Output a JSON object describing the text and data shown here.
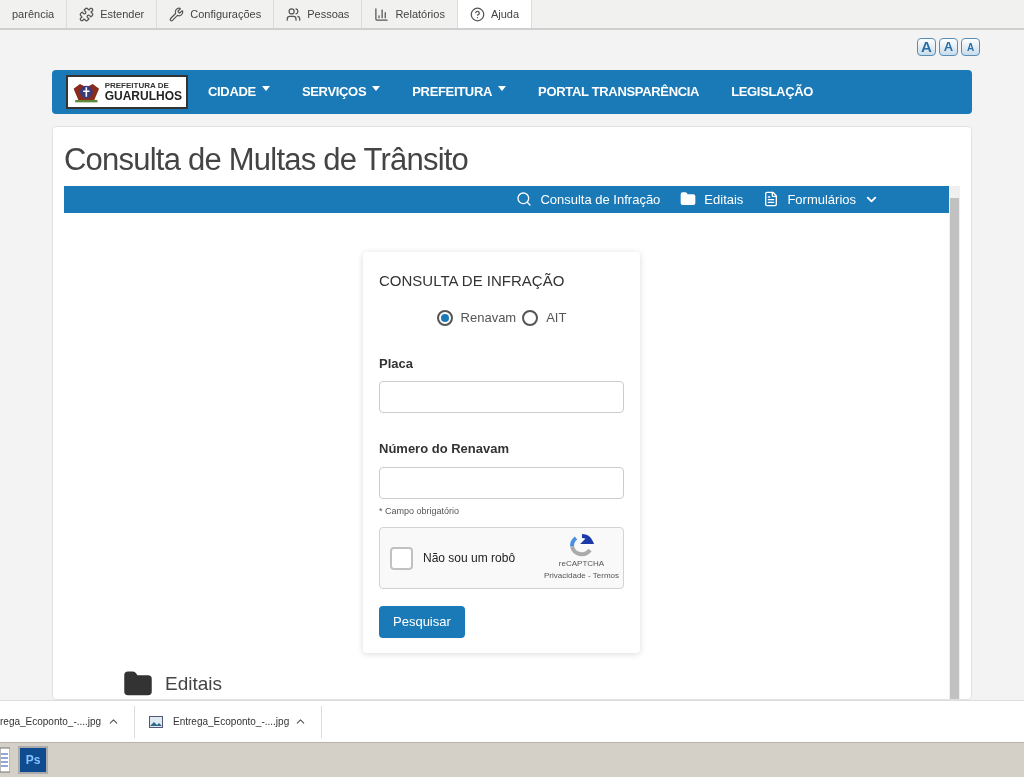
{
  "admin_toolbar": [
    {
      "label": "parência",
      "selected": false
    },
    {
      "label": "Estender",
      "selected": false
    },
    {
      "label": "Configurações",
      "selected": false
    },
    {
      "label": "Pessoas",
      "selected": false
    },
    {
      "label": "Relatórios",
      "selected": false
    },
    {
      "label": "Ajuda",
      "selected": true
    }
  ],
  "font_size_buttons": [
    {
      "label": "A",
      "kind": "large"
    },
    {
      "label": "A",
      "kind": "medium"
    },
    {
      "label": "A",
      "kind": "small"
    }
  ],
  "site_nav": {
    "logo": {
      "line_1": "PREFEITURA DE",
      "line_2": "GUARULHOS"
    },
    "items": [
      {
        "label": "CIDADE",
        "dropdown": true
      },
      {
        "label": "SERVIÇOS",
        "dropdown": true
      },
      {
        "label": "PREFEITURA",
        "dropdown": true
      },
      {
        "label": "PORTAL TRANSPARÊNCIA",
        "dropdown": false
      },
      {
        "label": "LEGISLAÇÃO",
        "dropdown": false
      }
    ]
  },
  "page_title": "Consulta de Multas de Trânsito",
  "sub_nav": [
    {
      "label": "Consulta de Infração",
      "dropdown": false
    },
    {
      "label": "Editais",
      "dropdown": false
    },
    {
      "label": "Formulários",
      "dropdown": true
    }
  ],
  "form": {
    "title": "CONSULTA DE INFRAÇÃO",
    "options": [
      {
        "label": "Renavam",
        "selected": true
      },
      {
        "label": "AIT",
        "selected": false
      }
    ],
    "fields": [
      {
        "label": "Placa"
      },
      {
        "label": "Número do Renavam"
      }
    ],
    "required_note": "* Campo obrigatório",
    "captcha": {
      "label": "Não sou um robô",
      "checked": false,
      "brand": "reCAPTCHA",
      "links": "Privacidade - Termos"
    },
    "submit": "Pesquisar"
  },
  "section_heading": "Editais",
  "downloads": [
    {
      "name": "rega_Ecoponto_-....jpg",
      "kind": "cut"
    },
    {
      "name": "Entrega_Ecoponto_-....jpg",
      "kind": "image"
    }
  ],
  "taskbar": [
    {
      "kind": "doc"
    },
    {
      "label": "Ps",
      "kind": "app"
    }
  ]
}
